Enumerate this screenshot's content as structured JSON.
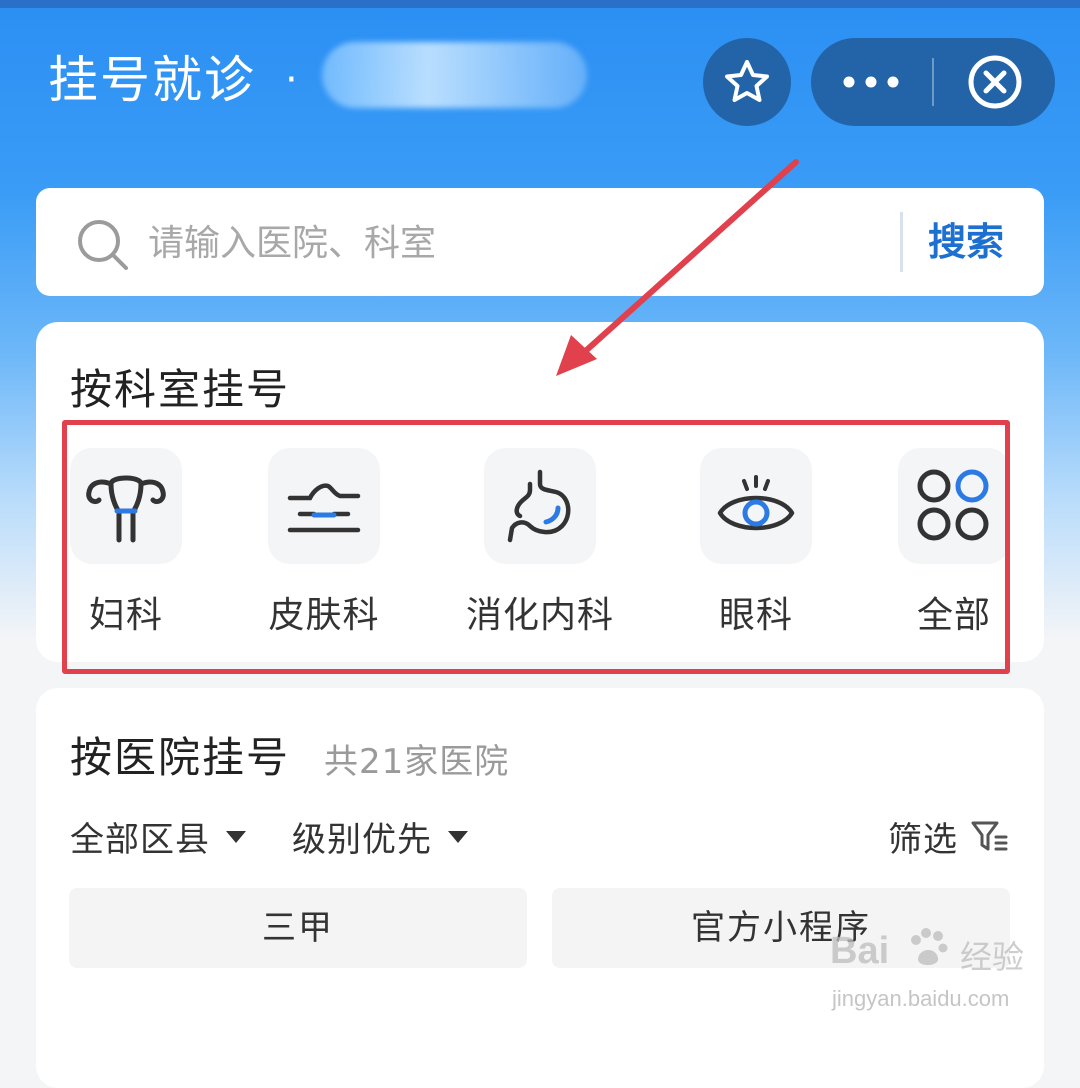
{
  "header": {
    "title": "挂号就诊",
    "separator": "·"
  },
  "search": {
    "placeholder": "请输入医院、科室",
    "button_label": "搜索"
  },
  "departments": {
    "title": "按科室挂号",
    "items": [
      {
        "label": "妇科",
        "icon": "uterus-icon"
      },
      {
        "label": "皮肤科",
        "icon": "skin-icon"
      },
      {
        "label": "消化内科",
        "icon": "stomach-icon"
      },
      {
        "label": "眼科",
        "icon": "eye-icon"
      },
      {
        "label": "全部",
        "icon": "grid-icon"
      }
    ]
  },
  "hospitals": {
    "title": "按医院挂号",
    "count_text": "共21家医院",
    "district_filter": "全部区县",
    "sort_filter": "级别优先",
    "filter_label": "筛选",
    "chips": [
      "三甲",
      "官方小程序"
    ]
  },
  "watermark": {
    "brand": "Bai",
    "brand_tail": "经验",
    "url": "jingyan.baidu.com"
  },
  "colors": {
    "accent": "#1d6fd0",
    "icon_accent": "#2c7be5",
    "highlight": "#e1404d"
  }
}
